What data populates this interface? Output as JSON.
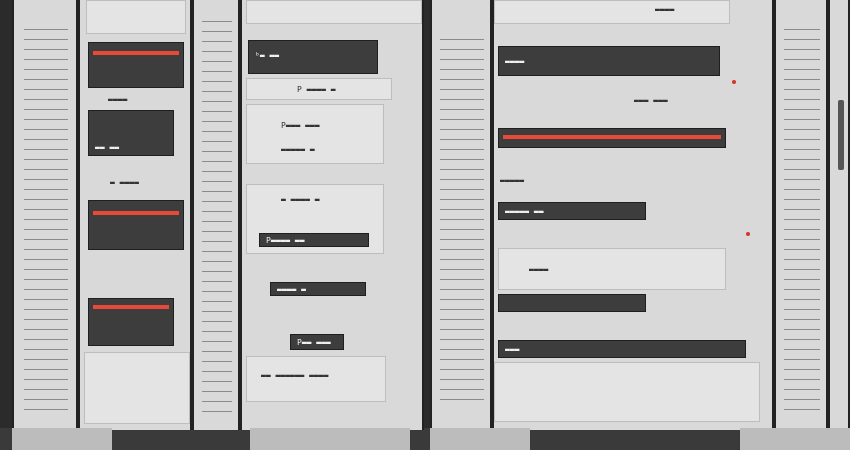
{
  "labels": {
    "left_cab_1": "▬▬▬▬",
    "left_cab_2": "▬▬ ▬▬",
    "left_cab_3": "▬ ▬▬▬▬",
    "mid_top": "ᵇ▬ ▬▬",
    "mid_2": "P ▬▬▬▬ ▬",
    "mid_3": "P▬▬▬ ▬▬▬",
    "mid_4": "▬▬▬▬▬ ▬",
    "mid_5": "▬ ▬▬▬▬ ▬",
    "mid_6": "P▬▬▬▬ ▬▬",
    "mid_7": "▬▬▬▬ ▬",
    "mid_badge": "P▬▬ ▬▬▬",
    "mid_bottom": "▬▬ ▬▬▬▬▬▬ ▬▬▬▬",
    "right_top": "▬▬▬▬",
    "right_2": "▬▬▬▬",
    "right_3": "▬▬▬ ▬▬▬",
    "right_4": "▬▬▬▬▬",
    "right_5": "▬▬▬▬▬ ▬▬",
    "right_6": "▬▬▬▬",
    "right_7": "▬▬▬"
  },
  "colors": {
    "accent_red": "#e84a3a",
    "cabinet": "#d9d9d9",
    "module_dark": "#3d3d3d"
  }
}
